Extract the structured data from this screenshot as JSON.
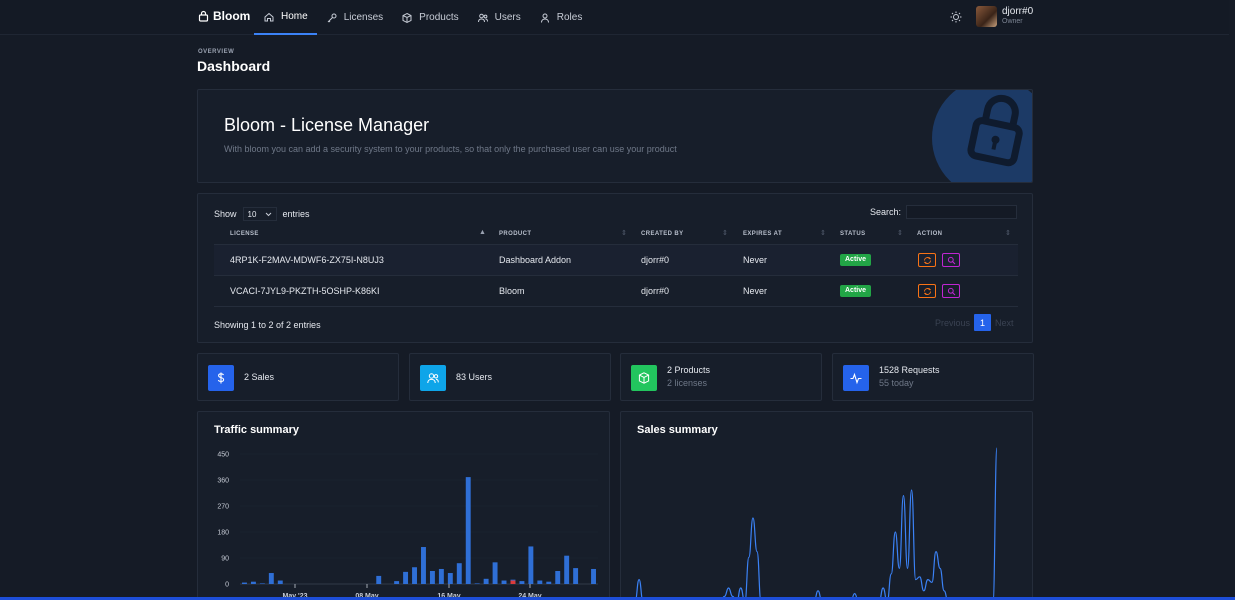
{
  "brand": {
    "name": "Bloom"
  },
  "nav": [
    {
      "label": "Home",
      "icon": "home-icon"
    },
    {
      "label": "Licenses",
      "icon": "key-icon"
    },
    {
      "label": "Products",
      "icon": "box-icon"
    },
    {
      "label": "Users",
      "icon": "users-icon"
    },
    {
      "label": "Roles",
      "icon": "user-icon"
    }
  ],
  "user": {
    "name": "djorr#0",
    "role": "Owner"
  },
  "header": {
    "overline": "OVERVIEW",
    "title": "Dashboard"
  },
  "hero": {
    "title": "Bloom - License Manager",
    "subtitle": "With bloom you can add a security system to your products, so that only the purchased user can use your product"
  },
  "table": {
    "show_label": "Show",
    "entries_value": "10",
    "entries_label": "entries",
    "search_label": "Search:",
    "search_value": "",
    "columns": [
      "LICENSE",
      "PRODUCT",
      "CREATED BY",
      "EXPIRES AT",
      "STATUS",
      "ACTION"
    ],
    "rows": [
      {
        "license": "4RP1K-F2MAV-MDWF6-ZX75I-N8UJ3",
        "product": "Dashboard Addon",
        "created_by": "djorr#0",
        "expires_at": "Never",
        "status": "Active"
      },
      {
        "license": "VCACI-7JYL9-PKZTH-5OSHP-K86KI",
        "product": "Bloom",
        "created_by": "djorr#0",
        "expires_at": "Never",
        "status": "Active"
      }
    ],
    "info": "Showing 1 to 2 of 2 entries",
    "pager": {
      "prev": "Previous",
      "current": "1",
      "next": "Next"
    }
  },
  "stats": [
    {
      "main": "2 Sales",
      "sub": "",
      "color": "#2563eb",
      "icon": "dollar-icon"
    },
    {
      "main": "83 Users",
      "sub": "",
      "color": "#0ea5e9",
      "icon": "users-icon"
    },
    {
      "main": "2 Products",
      "sub": "2 licenses",
      "color": "#22c55e",
      "icon": "box-icon"
    },
    {
      "main": "1528 Requests",
      "sub": "55 today",
      "color": "#2563eb",
      "icon": "activity-icon"
    }
  ],
  "colors": {
    "accent": "#2563eb",
    "active": "#22a546",
    "bar_blue": "#2f6fd6",
    "bar_red": "#dc3b3b",
    "line_blue": "#3b82f6"
  },
  "chart_data": [
    {
      "type": "bar",
      "title": "Traffic summary",
      "ylim": [
        0,
        450
      ],
      "yticks": [
        "450",
        "360",
        "270",
        "180",
        "90",
        "0"
      ],
      "xticks": [
        "May '23",
        "08 May",
        "16 May",
        "24 May"
      ],
      "series": [
        {
          "values": [
            5,
            8,
            2,
            38,
            12,
            0,
            0,
            0,
            0,
            0,
            0,
            0,
            0,
            0,
            0,
            28,
            0,
            10,
            42,
            58,
            128,
            45,
            52,
            38,
            72,
            370,
            2,
            18,
            75,
            12,
            15,
            10,
            130,
            12,
            8,
            45,
            98,
            55,
            0,
            52
          ]
        },
        {
          "values": [
            0,
            0,
            0,
            0,
            0,
            0,
            0,
            0,
            0,
            0,
            0,
            0,
            0,
            0,
            0,
            0,
            0,
            0,
            0,
            0,
            0,
            0,
            0,
            0,
            0,
            0,
            0,
            0,
            0,
            0,
            12,
            0,
            0,
            0,
            0,
            0,
            0,
            0,
            0,
            0
          ]
        }
      ]
    },
    {
      "type": "line",
      "title": "Sales summary",
      "x": [
        0,
        1,
        2,
        3,
        4,
        5,
        6,
        7,
        8,
        9,
        10,
        11,
        12,
        13,
        14,
        15,
        16,
        17,
        18,
        19,
        20,
        21,
        22,
        23,
        24,
        25,
        26,
        27,
        28,
        29,
        30,
        31,
        32,
        33,
        34,
        35,
        36,
        37,
        38,
        39,
        40,
        41,
        42,
        43,
        44,
        45,
        46,
        47,
        48,
        49,
        50,
        51,
        52,
        53,
        54,
        55,
        56,
        57,
        58,
        59,
        60,
        61,
        62,
        63,
        64,
        65,
        66,
        67,
        68,
        69,
        70,
        71,
        72,
        73,
        74,
        75,
        76,
        77,
        78,
        79,
        80,
        81,
        82,
        83,
        84,
        85,
        86,
        87,
        88,
        89
      ],
      "y": [
        0,
        8,
        0,
        0,
        0,
        0,
        0,
        0,
        0,
        0,
        0,
        0,
        0,
        0,
        0,
        0,
        0,
        0,
        0,
        0,
        0,
        0,
        2,
        5,
        2,
        0,
        5,
        0,
        16,
        30,
        18,
        0,
        0,
        0,
        0,
        0,
        0,
        0,
        0,
        0,
        0,
        0,
        0,
        0,
        0,
        4,
        0,
        0,
        0,
        0,
        0,
        0,
        0,
        0,
        3,
        0,
        0,
        0,
        0,
        0,
        0,
        5,
        0,
        10,
        25,
        12,
        38,
        12,
        40,
        8,
        9,
        4,
        8,
        7,
        18,
        12,
        4,
        0,
        0,
        0,
        0,
        0,
        0,
        0,
        0,
        0,
        0,
        0,
        0,
        55
      ]
    }
  ]
}
